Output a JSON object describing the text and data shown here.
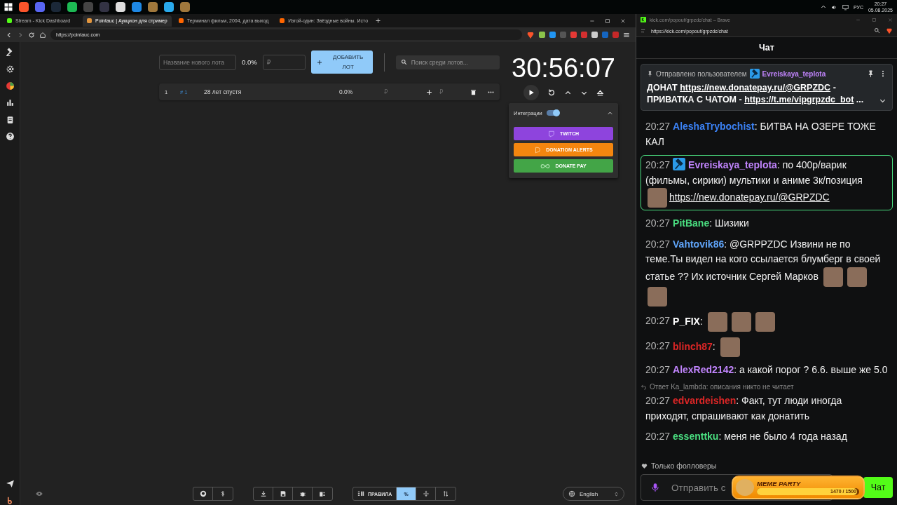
{
  "taskbar": {
    "language": "РУС",
    "time": "20:27",
    "date": "05.08.2025"
  },
  "browser": {
    "tabs": [
      {
        "title": "Stream - Kick Dashboard",
        "kind": "kick",
        "selected": false
      },
      {
        "title": "Pointauc | Аукцион для стример",
        "kind": "pointauc",
        "selected": true
      },
      {
        "title": "Терминал фильм, 2004, дата выход",
        "kind": "kinopoisk",
        "selected": false
      },
      {
        "title": "Изгой-один: Звёздные войны. Исто",
        "kind": "kinopoisk",
        "selected": false
      }
    ],
    "url": "https://pointauc.com"
  },
  "auction": {
    "new_lot": {
      "placeholder": "Название нового лота"
    },
    "new_lot_percent": "0.0%",
    "amount": {
      "placeholder": "₽"
    },
    "add_button": "ДОБАВИТЬ ЛОТ",
    "search": {
      "placeholder": "Поиск среди лотов..."
    },
    "lots": [
      {
        "index": "1",
        "id": "# 1",
        "name": "28 лет спустя",
        "percent": "0.0%",
        "amount_placeholder": "₽",
        "bid_placeholder": "₽"
      }
    ],
    "timer": "30:56:07",
    "integrations": {
      "label": "Интеграции",
      "on": true,
      "expanded": true,
      "services": [
        {
          "name": "TWITCH",
          "kind": "twitch"
        },
        {
          "name": "DONATION ALERTS",
          "kind": "donationalerts"
        },
        {
          "name": "DONATE PAY",
          "kind": "donatepay"
        }
      ]
    }
  },
  "bottom_bar": {
    "tools": [
      {
        "kind": "rules",
        "label": "ПРАВИЛА",
        "selected": false
      },
      {
        "kind": "percent",
        "label": "%",
        "selected": true
      },
      {
        "kind": "split",
        "selected": false
      },
      {
        "kind": "sort",
        "selected": false
      }
    ],
    "language": "English"
  },
  "chat": {
    "window_title": "kick.com/popout/grpzdc/chat – Brave",
    "url": "https://kick.com/popout/grpzdc/chat",
    "header": "Чат",
    "pinned": {
      "label": "Отправлено пользователем",
      "user": "Evreiskaya_teplota",
      "parts": [
        {
          "kind": "text",
          "text": "ДОНАТ "
        },
        {
          "kind": "link",
          "text": "https://new.donatepay.ru/@GRPZDC"
        },
        {
          "kind": "text",
          "text": " - ПРИВАТКА С ЧАТОМ - "
        },
        {
          "kind": "link",
          "text": "https://t.me/vipgrpzdc_bot"
        },
        {
          "kind": "text",
          "text": " ..."
        }
      ]
    },
    "messages": [
      {
        "time": "20:27",
        "user": "AleshaTrybochist",
        "color": "#3b82f6",
        "separator": ":",
        "badge": false,
        "highlighted": false,
        "parts": [
          {
            "kind": "text",
            "text": "БИТВА НА ОЗЕРЕ ТОЖЕ КАЛ"
          }
        ]
      },
      {
        "time": "20:27",
        "user": "Evreiskaya_teplota",
        "color": "#c084fc",
        "separator": ":",
        "badge": true,
        "highlighted": true,
        "parts": [
          {
            "kind": "text",
            "text": "по 400р/варик (фильмы, сирики) мультики и аниме 3к/позиция"
          },
          {
            "kind": "emote"
          },
          {
            "kind": "link",
            "text": "https://new.donatepay.ru/@GRPZDC"
          }
        ]
      },
      {
        "time": "20:27",
        "user": "PitBane",
        "color": "#4ade80",
        "separator": ":",
        "badge": false,
        "highlighted": false,
        "parts": [
          {
            "kind": "text",
            "text": "Шизики"
          }
        ]
      },
      {
        "time": "20:27",
        "user": "Vahtovik86",
        "color": "#60a5fa",
        "separator": ":",
        "badge": false,
        "highlighted": false,
        "parts": [
          {
            "kind": "text",
            "text": "@GRPPZDC Извини не по теме.Ты видел на кого ссылается блумберг в своей статье ?? Их источник Сергей Марков"
          },
          {
            "kind": "emote"
          },
          {
            "kind": "emote"
          },
          {
            "kind": "emote"
          }
        ]
      },
      {
        "time": "20:27",
        "user": "P_FIX",
        "color": "#ffffff",
        "separator": ":",
        "badge": false,
        "highlighted": false,
        "parts": [
          {
            "kind": "emote"
          },
          {
            "kind": "emote"
          },
          {
            "kind": "emote"
          }
        ]
      },
      {
        "time": "20:27",
        "user": "blinch87",
        "color": "#dc2626",
        "separator": ":",
        "badge": false,
        "highlighted": false,
        "parts": [
          {
            "kind": "emote"
          }
        ]
      },
      {
        "time": "20:27",
        "user": "AlexRed2142",
        "color": "#c084fc",
        "separator": ":",
        "badge": false,
        "highlighted": false,
        "parts": [
          {
            "kind": "text",
            "text": "а какой порог ? 6.6. выше же 5.0"
          }
        ]
      },
      {
        "time": "20:27",
        "user": "edvardeishen",
        "color": "#dc2626",
        "separator": ":",
        "badge": false,
        "highlighted": false,
        "reply": "Ответ Ka_lambda: описания никто не читает",
        "parts": [
          {
            "kind": "text",
            "text": "Факт, тут люди иногда приходят, спрашивают как донатить"
          }
        ]
      },
      {
        "time": "20:27",
        "user": "essenttku",
        "color": "#4ade80",
        "separator": ":",
        "badge": false,
        "highlighted": false,
        "parts": [
          {
            "kind": "text",
            "text": "меня не было 4 года назад"
          }
        ]
      }
    ],
    "mode": "Только фолловеры",
    "input": {
      "placeholder": "Отправить с"
    },
    "meme_party": {
      "title": "MEME PARTY",
      "progress": "1470 / 1500",
      "level": 0.98
    },
    "send_button": "Чат"
  }
}
